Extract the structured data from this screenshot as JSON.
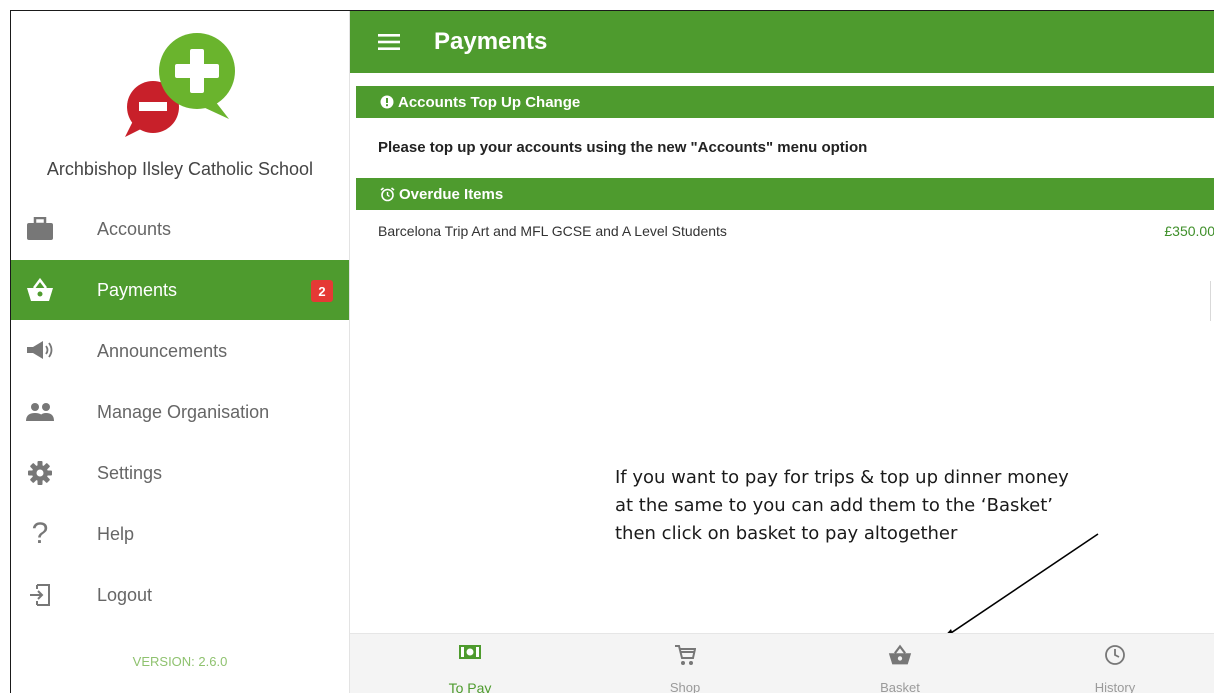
{
  "sidebar": {
    "school_name": "Archbishop Ilsley Catholic School",
    "items": [
      {
        "label": "Accounts",
        "icon": "briefcase-icon"
      },
      {
        "label": "Payments",
        "icon": "basket-icon",
        "badge": "2"
      },
      {
        "label": "Announcements",
        "icon": "megaphone-icon"
      },
      {
        "label": "Manage Organisation",
        "icon": "people-icon"
      },
      {
        "label": "Settings",
        "icon": "gear-icon"
      },
      {
        "label": "Help",
        "icon": "question-icon"
      },
      {
        "label": "Logout",
        "icon": "logout-icon"
      }
    ],
    "version": "VERSION: 2.6.0"
  },
  "header": {
    "title": "Payments"
  },
  "sections": {
    "accounts_top_up": {
      "title": "Accounts Top Up Change",
      "message": "Please top up your accounts using the new \"Accounts\" menu option"
    },
    "overdue": {
      "title": "Overdue Items",
      "items": [
        {
          "name": "Barcelona Trip Art and MFL GCSE and A Level Students",
          "amount": "£350.00"
        }
      ]
    }
  },
  "annotation": {
    "lines": [
      "If you want to pay for trips & top up dinner money",
      "at the same to you can add them to the ‘Basket’",
      "then click on basket to pay altogether"
    ]
  },
  "bottom_nav": [
    {
      "label": "To Pay",
      "icon": "cash-icon"
    },
    {
      "label": "Shop",
      "icon": "cart-icon"
    },
    {
      "label": "Basket",
      "icon": "basket-icon"
    },
    {
      "label": "History",
      "icon": "clock-icon"
    }
  ],
  "colors": {
    "brand_green": "#4e9b2e",
    "logo_green": "#6ab42d",
    "logo_red": "#c8202a",
    "badge_red": "#e53935"
  }
}
